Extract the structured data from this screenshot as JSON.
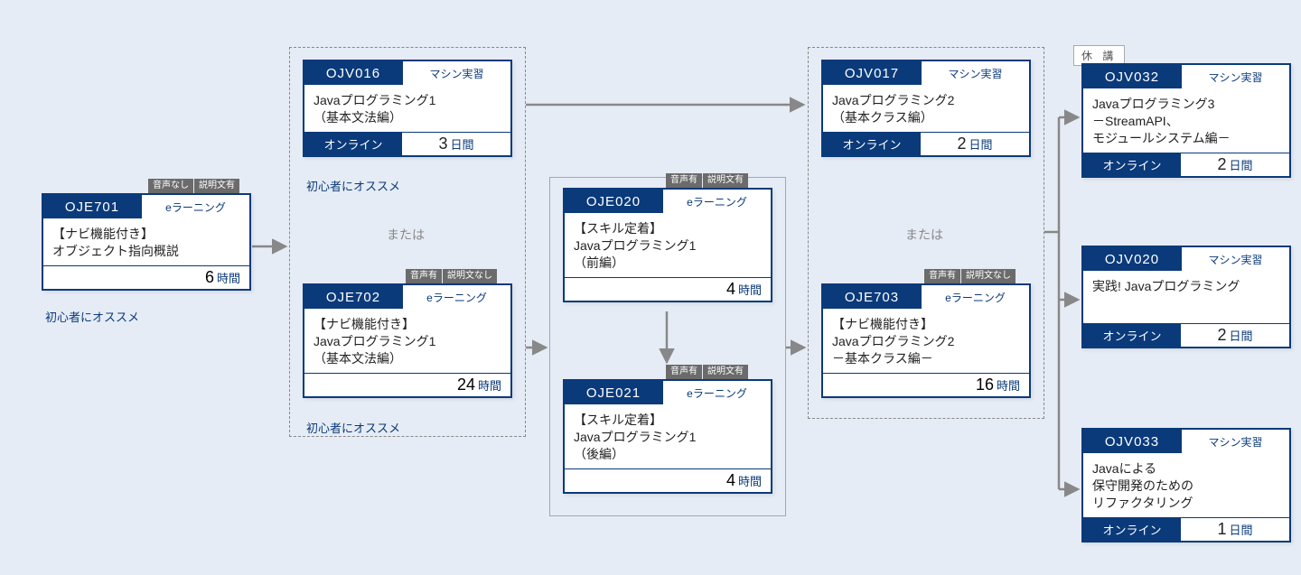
{
  "labels": {
    "or": "または",
    "beginner": "初心者にオススメ",
    "suspended": "休 講",
    "audio_no": "音声なし",
    "audio_yes": "音声有",
    "desc_yes": "説明文有",
    "desc_no": "説明文なし",
    "unit_hours": "時間",
    "unit_days": "日間"
  },
  "courses": {
    "oje701": {
      "code": "OJE701",
      "type": "eラーニング",
      "title": "【ナビ機能付き】\nオブジェクト指向概説",
      "duration": "6"
    },
    "ojv016": {
      "code": "OJV016",
      "type": "マシン実習",
      "title": "Javaプログラミング1\n（基本文法編）",
      "mode": "オンライン",
      "duration": "3"
    },
    "oje702": {
      "code": "OJE702",
      "type": "eラーニング",
      "title": "【ナビ機能付き】\nJavaプログラミング1\n（基本文法編）",
      "duration": "24"
    },
    "oje020": {
      "code": "OJE020",
      "type": "eラーニング",
      "title": "【スキル定着】\nJavaプログラミング1\n（前編）",
      "duration": "4"
    },
    "oje021": {
      "code": "OJE021",
      "type": "eラーニング",
      "title": "【スキル定着】\nJavaプログラミング1\n（後編）",
      "duration": "4"
    },
    "ojv017": {
      "code": "OJV017",
      "type": "マシン実習",
      "title": "Javaプログラミング2\n（基本クラス編）",
      "mode": "オンライン",
      "duration": "2"
    },
    "oje703": {
      "code": "OJE703",
      "type": "eラーニング",
      "title": "【ナビ機能付き】\nJavaプログラミング2\n－基本クラス編－",
      "duration": "16"
    },
    "ojv032": {
      "code": "OJV032",
      "type": "マシン実習",
      "title": "Javaプログラミング3\n－StreamAPI、\nモジュールシステム編－",
      "mode": "オンライン",
      "duration": "2"
    },
    "ojv020": {
      "code": "OJV020",
      "type": "マシン実習",
      "title": "実践! Javaプログラミング",
      "mode": "オンライン",
      "duration": "2"
    },
    "ojv033": {
      "code": "OJV033",
      "type": "マシン実習",
      "title": "Javaによる\n保守開発のための\nリファクタリング",
      "mode": "オンライン",
      "duration": "1"
    }
  }
}
